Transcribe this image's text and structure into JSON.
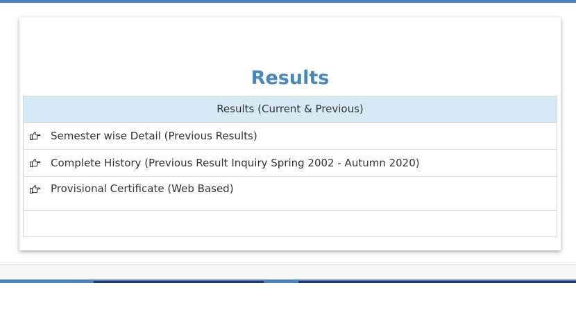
{
  "page": {
    "title": "Results"
  },
  "results_table": {
    "header": "Results (Current & Previous)",
    "rows": [
      {
        "label": "Semester wise Detail (Previous Results)",
        "icon": "hand-point-right-icon"
      },
      {
        "label": "Complete History (Previous Result Inquiry Spring 2002 - Autumn 2020)",
        "icon": "hand-point-right-icon"
      },
      {
        "label": "Provisional Certificate (Web Based)",
        "icon": "hand-point-right-icon"
      }
    ]
  },
  "colors": {
    "accent": "#4f81bd",
    "title": "#4a86b8",
    "header_bg": "#d6eaf5"
  }
}
